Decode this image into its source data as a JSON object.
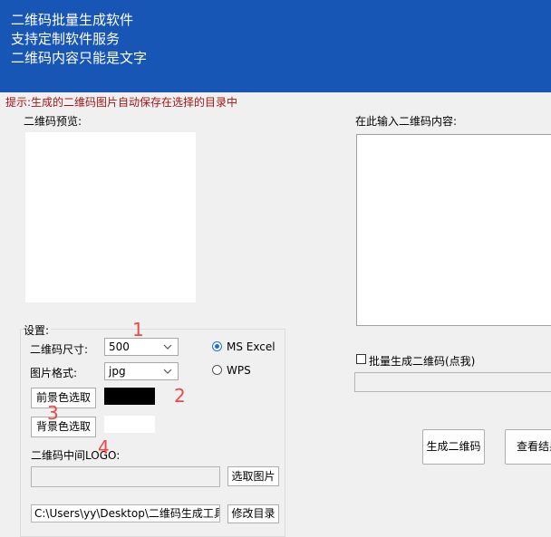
{
  "header": {
    "line1": "二维码批量生成软件",
    "line2": "支持定制软件服务",
    "line3": "二维码内容只能是文字"
  },
  "tip": "提示:生成的二维码图片自动保存在选择的目录中",
  "preview": {
    "label": "二维码预览:"
  },
  "content": {
    "label": "在此输入二维码内容:"
  },
  "settings": {
    "title": "设置:",
    "size_label": "二维码尺寸:",
    "size_value": "500",
    "format_label": "图片格式:",
    "format_value": "jpg",
    "radio_ms": "MS  Excel",
    "radio_wps": "WPS",
    "fg_button": "前景色选取",
    "bg_button": "背景色选取",
    "fg_color": "#000000",
    "bg_color": "#ffffff",
    "logo_label": "二维码中间LOGO:",
    "pick_image_button": "选取图片",
    "path_value": "C:\\Users\\yy\\Desktop\\二维码生成工具",
    "change_dir_button": "修改目录"
  },
  "batch": {
    "checkbox_label": "批量生成二维码(点我)"
  },
  "actions": {
    "generate_button": "生成二维码",
    "view_button": "查看结果"
  },
  "annotations": [
    "1",
    "2",
    "3",
    "4"
  ]
}
